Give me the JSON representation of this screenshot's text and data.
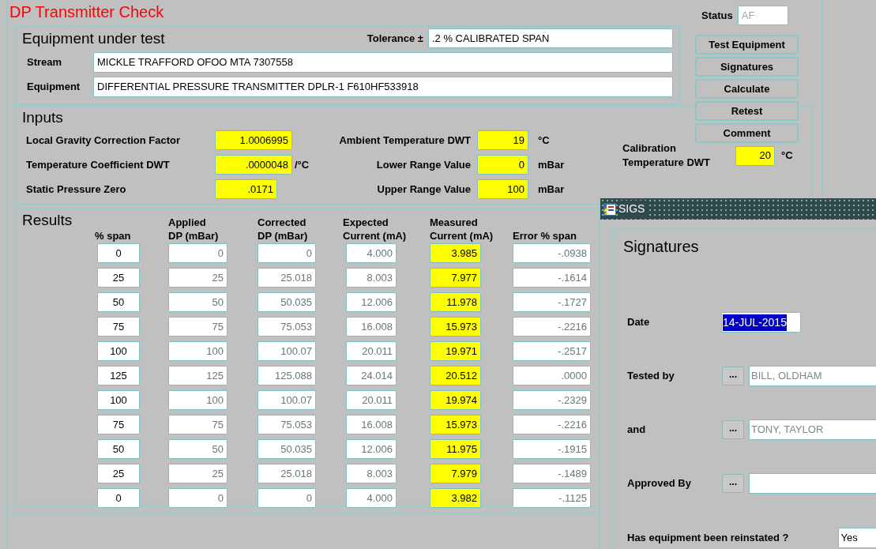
{
  "window": {
    "title": "DP Transmitter Check"
  },
  "status": {
    "label": "Status",
    "value": "AF",
    "disabled": true
  },
  "buttons": [
    "Test Equipment",
    "Signatures",
    "Calculate",
    "Retest",
    "Comment"
  ],
  "equipment_panel": {
    "title": "Equipment under test",
    "tolerance": {
      "label": "Tolerance ±",
      "value": ".2 % CALIBRATED SPAN"
    },
    "fields": [
      {
        "label": "Stream",
        "value": "MICKLE TRAFFORD OFOO MTA 7307558"
      },
      {
        "label": "Equipment",
        "value": "DIFFERENTIAL PRESSURE TRANSMITTER DPLR-1 F610HF533918"
      }
    ]
  },
  "inputs_panel": {
    "title": "Inputs",
    "left": [
      {
        "label": "Local Gravity Correction Factor",
        "value": "1.0006995",
        "kind": "required"
      },
      {
        "label": "Temperature Coefficient DWT",
        "value": ".0000048",
        "unit": "/°C",
        "kind": "required"
      },
      {
        "label": "Static Pressure Zero",
        "value": ".0171",
        "kind": "required"
      }
    ],
    "right": [
      {
        "label": "Ambient Temperature DWT",
        "value": "19",
        "unit": "°C",
        "kind": "required"
      },
      {
        "label": "Lower Range Value",
        "value": "0",
        "unit": "mBar",
        "kind": "required"
      },
      {
        "label": "Upper Range Value",
        "value": "100",
        "unit": "mBar",
        "kind": "required"
      }
    ],
    "calibration": {
      "label_lines": [
        "Calibration",
        "Temperature DWT"
      ],
      "value": "20",
      "unit": "°C",
      "kind": "required"
    }
  },
  "results_panel": {
    "title": "Results",
    "columns": [
      {
        "heading": [
          "% span"
        ],
        "kind": "entry"
      },
      {
        "heading": [
          "Applied",
          "DP (mBar)"
        ],
        "kind": "display"
      },
      {
        "heading": [
          "Corrected",
          "DP (mBar)"
        ],
        "kind": "display"
      },
      {
        "heading": [
          "Expected",
          "Current (mA)"
        ],
        "kind": "display"
      },
      {
        "heading": [
          "Measured",
          "Current (mA)"
        ],
        "kind": "required"
      },
      {
        "heading": [
          "Error % span"
        ],
        "kind": "display"
      }
    ],
    "rows": [
      [
        "0",
        "0",
        "0",
        "4.000",
        "3.985",
        "-.0938"
      ],
      [
        "25",
        "25",
        "25.018",
        "8.003",
        "7.977",
        "-.1614"
      ],
      [
        "50",
        "50",
        "50.035",
        "12.006",
        "11.978",
        "-.1727"
      ],
      [
        "75",
        "75",
        "75.053",
        "16.008",
        "15.973",
        "-.2216"
      ],
      [
        "100",
        "100",
        "100.07",
        "20.011",
        "19.971",
        "-.2517"
      ],
      [
        "125",
        "125",
        "125.088",
        "24.014",
        "20.512",
        ".0000"
      ],
      [
        "100",
        "100",
        "100.07",
        "20.011",
        "19.974",
        "-.2329"
      ],
      [
        "75",
        "75",
        "75.053",
        "16.008",
        "15.973",
        "-.2216"
      ],
      [
        "50",
        "50",
        "50.035",
        "12.006",
        "11.975",
        "-.1915"
      ],
      [
        "25",
        "25",
        "25.018",
        "8.003",
        "7.979",
        "-.1489"
      ],
      [
        "0",
        "0",
        "0",
        "4.000",
        "3.982",
        "-.1125"
      ]
    ]
  },
  "sigs_dialog": {
    "title": "SIGS",
    "heading": "Signatures",
    "date": {
      "label": "Date",
      "value": "14-JUL-2015",
      "selected": true
    },
    "people": [
      {
        "label": "Tested by",
        "button": "...",
        "value": "BILL, OLDHAM",
        "disabled": true
      },
      {
        "label": "and",
        "button": "...",
        "value": "TONY, TAYLOR",
        "disabled": true
      },
      {
        "label": "Approved By",
        "button": "..."
      }
    ],
    "reinstated": {
      "label": "Has equipment been reinstated ?",
      "value": "Yes"
    }
  }
}
